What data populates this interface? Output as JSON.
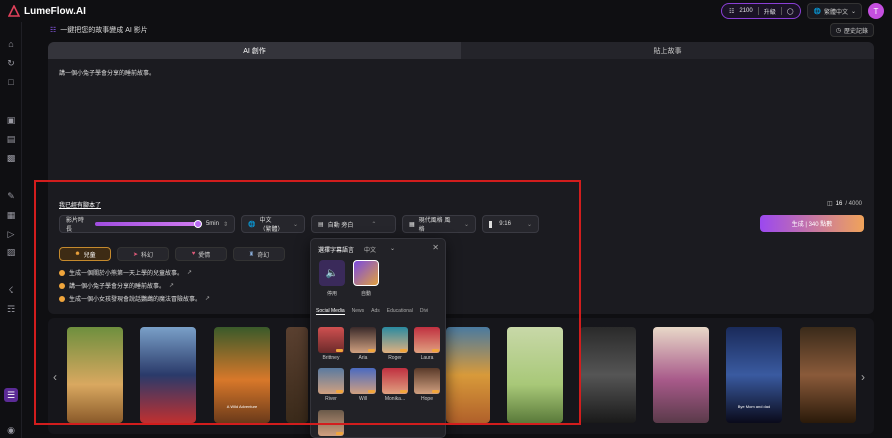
{
  "app": {
    "logo_text": "LumeFlow.AI"
  },
  "topbar": {
    "credits": "2100",
    "upgrade": "升級",
    "language": "繁體中文",
    "avatar_letter": "T"
  },
  "page": {
    "heading": "一鍵把您的故事變成 AI 影片",
    "history_button": "歷史記錄"
  },
  "tabs": [
    {
      "label": "AI 創作",
      "active": true
    },
    {
      "label": "貼上故事",
      "active": false
    }
  ],
  "editor": {
    "story_text": "講一個小兔子學會分享的睡前故事。",
    "script_link": "我已經有腳本了",
    "char_count": "16",
    "char_max": "/ 4000"
  },
  "controls": {
    "duration_label": "影片時長",
    "duration_value": "5min",
    "duration_fraction": 0.93,
    "language": "中文（繁體）",
    "voice": "自動 旁白",
    "style": "現代風格 風格",
    "aspect": "9:16",
    "generate": "生成 | 340 點數"
  },
  "chips": [
    {
      "label": "兒童",
      "active": true
    },
    {
      "label": "科幻",
      "active": false
    },
    {
      "label": "愛情",
      "active": false
    },
    {
      "label": "奇幻",
      "active": false
    }
  ],
  "suggestions": [
    "生成一個關於小熊第一天上學的兒童故事。",
    "講一個小兔子學會分享的睡前故事。",
    "生成一個小女孩發現會說話鸚鵡的魔法冒險故事。"
  ],
  "popup": {
    "title": "選擇字幕語言",
    "language": "中文",
    "options": [
      {
        "label": "停用"
      },
      {
        "label": "自動"
      }
    ],
    "tabs": [
      "Social Media",
      "News",
      "Ads",
      "Educational",
      "Divi"
    ],
    "voices": [
      "Brittney",
      "Aria",
      "Roger",
      "Laura",
      "River",
      "Will",
      "Monika...",
      "Hope"
    ]
  },
  "gallery": {
    "captions": [
      "",
      "",
      "A Wild Adventure",
      "",
      "",
      "",
      "",
      "",
      "",
      "",
      "Bye Mom and dad",
      "",
      ""
    ]
  },
  "colors": {
    "accent": "#9b48f0",
    "highlight": "#d21d1d",
    "chip_active": "#c58a2d"
  }
}
